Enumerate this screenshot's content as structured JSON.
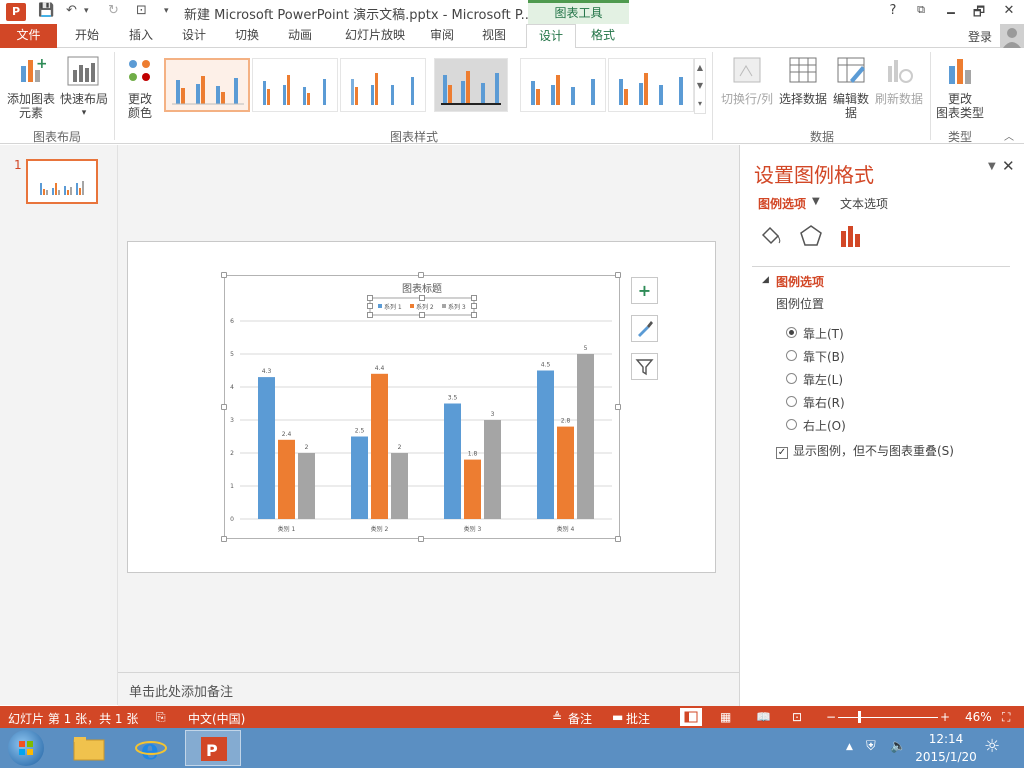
{
  "window": {
    "title": "新建 Microsoft PowerPoint 演示文稿.pptx - Microsoft P...",
    "context_tab_group": "图表工具",
    "help": "?",
    "minimize": "🗕",
    "restore": "🗗",
    "close": "✕",
    "ribbon_display": "⧉",
    "login": "登录"
  },
  "tabs": [
    "文件",
    "开始",
    "插入",
    "设计",
    "切换",
    "动画",
    "幻灯片放映",
    "审阅",
    "视图",
    "设计",
    "格式"
  ],
  "ribbon": {
    "add_element_1": "添加图表",
    "add_element_2": "元素",
    "quick_layout": "快速布局",
    "change_color_1": "更改",
    "change_color_2": "颜色",
    "group_layout": "图表布局",
    "group_styles": "图表样式",
    "switch_row_col": "切换行/列",
    "select_data": "选择数据",
    "edit_data_1": "编辑数",
    "edit_data_2": "据",
    "refresh_data": "刷新数据",
    "group_data": "数据",
    "change_type_1": "更改",
    "change_type_2": "图表类型",
    "group_type": "类型"
  },
  "thumbs": {
    "slide_number": "1"
  },
  "chart_data": {
    "type": "bar",
    "title": "图表标题",
    "categories": [
      "类别 1",
      "类别 2",
      "类别 3",
      "类别 4"
    ],
    "series": [
      {
        "name": "系列 1",
        "values": [
          4.3,
          2.5,
          3.5,
          4.5
        ],
        "color": "#5b9bd5"
      },
      {
        "name": "系列 2",
        "values": [
          2.4,
          4.4,
          1.8,
          2.8
        ],
        "color": "#ed7d31"
      },
      {
        "name": "系列 3",
        "values": [
          2,
          2,
          3,
          5
        ],
        "color": "#a5a5a5"
      }
    ],
    "ylim": [
      0,
      6
    ],
    "yticks": [
      "0",
      "1",
      "2",
      "3",
      "4",
      "5",
      "6"
    ],
    "legend_position": "top",
    "grid": true
  },
  "notes": {
    "placeholder": "单击此处添加备注"
  },
  "pane": {
    "title": "设置图例格式",
    "tab_legend": "图例选项",
    "tab_text": "文本选项",
    "section": "图例选项",
    "position_label": "图例位置",
    "options": [
      "靠上(T)",
      "靠下(B)",
      "靠左(L)",
      "靠右(R)",
      "右上(O)"
    ],
    "selected": "靠上(T)",
    "overlap": "显示图例，但不与图表重叠(S)",
    "overlap_checked": true
  },
  "status": {
    "slide_info": "幻灯片 第 1 张，共 1 张",
    "language": "中文(中国)",
    "notes": "备注",
    "comments": "批注",
    "zoom": "46%"
  },
  "taskbar": {
    "time": "12:14",
    "date": "2015/1/20"
  }
}
